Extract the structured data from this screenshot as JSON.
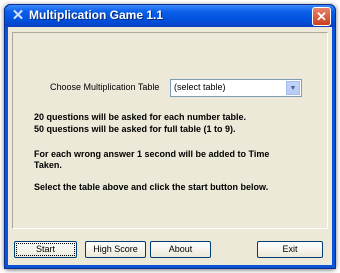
{
  "window": {
    "title": "Multiplication Game 1.1"
  },
  "form": {
    "choose_label": "Choose Multiplication Table",
    "select_value": "(select table)",
    "info_line1": "20 questions will be asked for each number table.",
    "info_line2": "50 questions will be asked for full table (1 to 9).",
    "info_line3": "For each wrong answer 1 second will be added to Time",
    "info_line4": "Taken.",
    "info_line5": "Select the table above and click the start button below."
  },
  "buttons": {
    "start": "Start",
    "high_score": "High Score",
    "about": "About",
    "exit": "Exit"
  },
  "icons": {
    "app": "app-icon",
    "close": "close-icon",
    "dropdown": "chevron-down-icon"
  }
}
